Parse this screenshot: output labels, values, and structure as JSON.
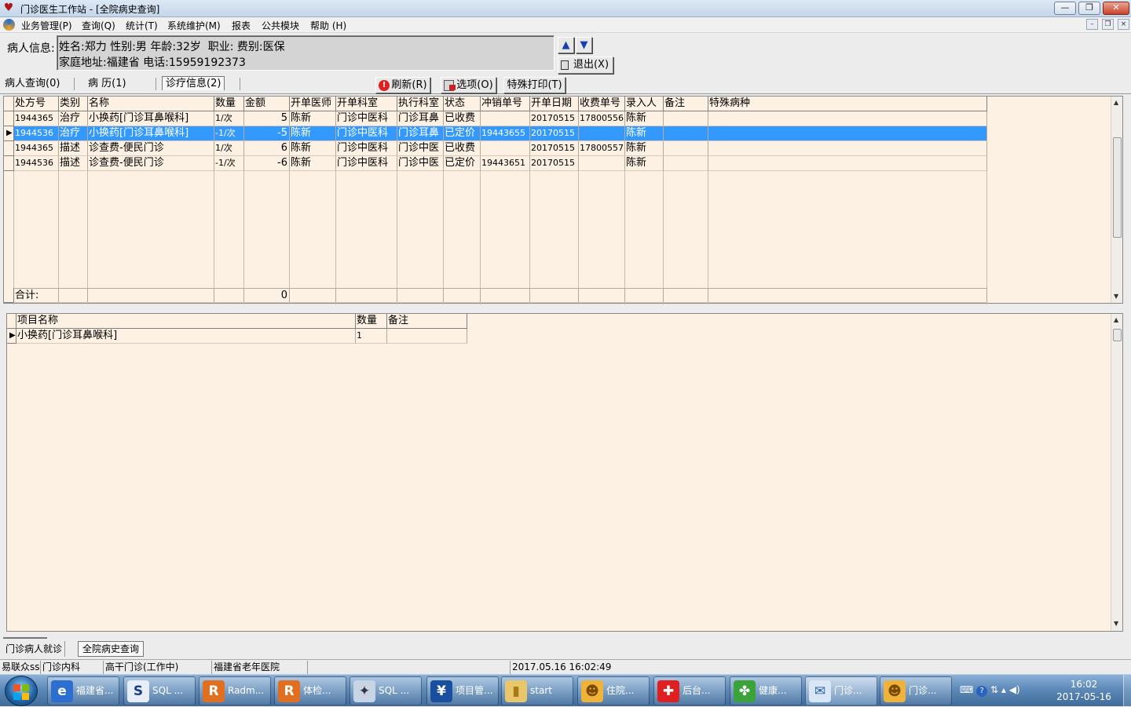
{
  "window": {
    "title": "门诊医生工作站 - [全院病史查询]",
    "minimize": "—",
    "maximize": "❐",
    "close": "✕"
  },
  "menu": [
    "业务管理(P)",
    "查询(Q)",
    "统计(T)",
    "系统维护(M)",
    "报表",
    "公共模块",
    "帮助 (H)"
  ],
  "mdi": {
    "minimize": "–",
    "restore": "❐",
    "close": "×"
  },
  "patient": {
    "label": "病人信息:",
    "line1": "姓名:郑力 性别:男 年龄:32岁  职业: 费别:医保",
    "line2": "家庭地址:福建省 电话:15959192373"
  },
  "nav": {
    "up": "▲",
    "down": "▼",
    "exit": "退出(X)"
  },
  "tabs": [
    "病人查询(0)",
    "病  历(1)",
    "诊疗信息(2)"
  ],
  "toolbar": {
    "refresh": "刷新(R)",
    "options": "选项(O)",
    "special_print": "特殊打印(T)"
  },
  "grid1": {
    "headers": [
      "处方号",
      "类别",
      "名称",
      "数量",
      "金额",
      "开单医师",
      "开单科室",
      "执行科室",
      "状态",
      "冲销单号",
      "开单日期",
      "收费单号",
      "录入人",
      "备注",
      "特殊病种"
    ],
    "rows": [
      [
        "1944365",
        "治疗",
        "小换药[门诊耳鼻喉科]",
        "1/次",
        "5",
        "陈新",
        "门诊中医科",
        "门诊耳鼻",
        "已收费",
        "",
        "20170515",
        "17800556",
        "陈新",
        "",
        ""
      ],
      [
        "1944536",
        "治疗",
        "小换药[门诊耳鼻喉科]",
        "-1/次",
        "-5",
        "陈新",
        "门诊中医科",
        "门诊耳鼻",
        "已定价",
        "19443655",
        "20170515",
        "",
        "陈新",
        "",
        ""
      ],
      [
        "1944365",
        "描述",
        "诊查费-便民门诊",
        "1/次",
        "6",
        "陈新",
        "门诊中医科",
        "门诊中医",
        "已收费",
        "",
        "20170515",
        "17800557",
        "陈新",
        "",
        ""
      ],
      [
        "1944536",
        "描述",
        "诊查费-便民门诊",
        "-1/次",
        "-6",
        "陈新",
        "门诊中医科",
        "门诊中医",
        "已定价",
        "19443651",
        "20170515",
        "",
        "陈新",
        "",
        ""
      ]
    ],
    "selected_row": 1,
    "total_label": "合计:",
    "total_amount": "0"
  },
  "grid2": {
    "headers": [
      "项目名称",
      "数量",
      "备注"
    ],
    "rows": [
      [
        "小换药[门诊耳鼻喉科]",
        "1",
        ""
      ]
    ]
  },
  "bottom_tabs": [
    "门诊病人就诊",
    "全院病史查询"
  ],
  "status": [
    "易联众ss",
    "门诊内科",
    "高干门诊(工作中)",
    "福建省老年医院",
    "",
    "2017.05.16 16:02:49"
  ],
  "taskbar": {
    "items": [
      "福建省...",
      "SQL ...",
      "Radm...",
      "体检...",
      "SQL ...",
      "项目管...",
      "start",
      "住院...",
      "后台...",
      "健康...",
      "门诊...",
      "门诊..."
    ],
    "time": "16:02",
    "date": "2017-05-16"
  }
}
